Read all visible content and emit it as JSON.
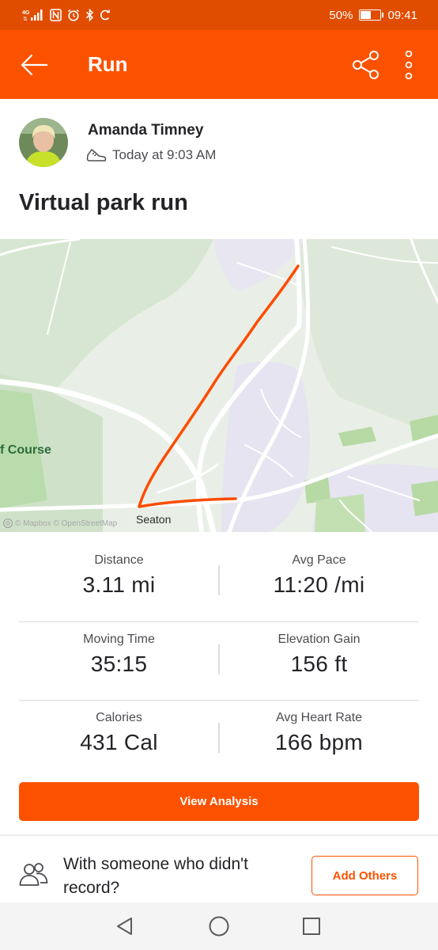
{
  "status_bar": {
    "network": "4G",
    "battery_text": "50%",
    "battery_level": 0.5,
    "time": "09:41",
    "icons": [
      "signal-icon",
      "nfc-icon",
      "alarm-icon",
      "bluetooth-icon",
      "sync-icon",
      "battery-icon"
    ]
  },
  "app_bar": {
    "title": "Run",
    "icons": [
      "back-arrow-icon",
      "share-icon",
      "more-vertical-icon"
    ]
  },
  "athlete": {
    "name": "Amanda Timney",
    "time_label": "Today at 9:03 AM",
    "activity_icon": "running-shoe-icon"
  },
  "activity": {
    "title": "Virtual park run"
  },
  "map": {
    "labels": {
      "course": "f Course",
      "town": "Seaton"
    },
    "attribution": "© Mapbox © OpenStreetMap",
    "route_color": "#fc4c02"
  },
  "stats": [
    [
      {
        "label": "Distance",
        "value": "3.11 mi"
      },
      {
        "label": "Avg Pace",
        "value": "11:20 /mi"
      }
    ],
    [
      {
        "label": "Moving Time",
        "value": "35:15"
      },
      {
        "label": "Elevation Gain",
        "value": "156 ft"
      }
    ],
    [
      {
        "label": "Calories",
        "value": "431 Cal"
      },
      {
        "label": "Avg Heart Rate",
        "value": "166 bpm"
      }
    ]
  ],
  "actions": {
    "view_analysis": "View Analysis",
    "with_others_text": "With someone who didn't record?",
    "add_others": "Add Others"
  },
  "nav_bar": {
    "icons": [
      "nav-back-icon",
      "nav-home-icon",
      "nav-recents-icon"
    ]
  },
  "colors": {
    "brand": "#fc5200",
    "status_bar": "#e04d00"
  }
}
